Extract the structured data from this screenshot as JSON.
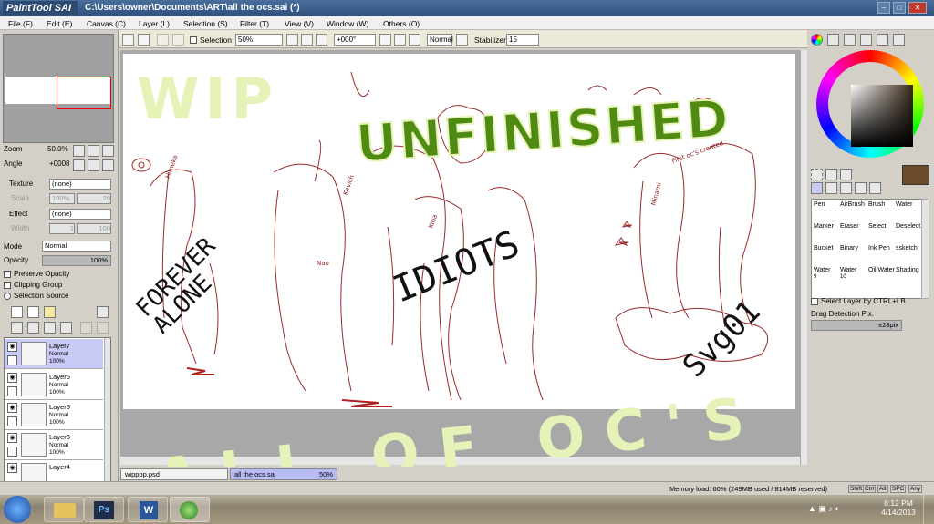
{
  "title": {
    "app_logo": "PaintTool SAI",
    "path": "C:\\Users\\owner\\Documents\\ART\\all the ocs.sai (*)"
  },
  "menu": [
    "File (F)",
    "Edit (E)",
    "Canvas (C)",
    "Layer (L)",
    "Selection (S)",
    "Filter (T)",
    "View (V)",
    "Window (W)",
    "Others (O)"
  ],
  "toolbar": {
    "selection_label": "Selection",
    "zoom": "50%",
    "rotation": "+000°",
    "blend": "Normal",
    "stabilizer_label": "Stabilizer",
    "stabilizer_value": "15"
  },
  "left": {
    "zoom_label": "Zoom",
    "zoom_value": "50.0%",
    "angle_label": "Angle",
    "angle_value": "+0008",
    "texture_label": "Texture",
    "texture_value": "(none)",
    "scale_label": "Scale",
    "scale_value": "100%",
    "scale_num": "20",
    "effect_label": "Effect",
    "effect_value": "(none)",
    "width_label": "Width",
    "width_value": "1",
    "width_num": "100",
    "mode_label": "Mode",
    "mode_value": "Normal",
    "opacity_label": "Opacity",
    "opacity_value": "100%",
    "preserve_opacity": "Preserve Opacity",
    "clipping_group": "Clipping Group",
    "selection_source": "Selection Source",
    "layers": [
      {
        "name": "Layer7",
        "mode": "Normal",
        "opacity": "100%"
      },
      {
        "name": "Layer6",
        "mode": "Normal",
        "opacity": "100%"
      },
      {
        "name": "Layer5",
        "mode": "Normal",
        "opacity": "100%"
      },
      {
        "name": "Layer3",
        "mode": "Normal",
        "opacity": "100%"
      },
      {
        "name": "Layer4",
        "mode": "",
        "opacity": ""
      }
    ]
  },
  "overlay_text": {
    "wip": "WIP",
    "unfinished": "UNFINISHED",
    "all_of_ocs": "ALL OF OC'S",
    "forever_alone": "FOREVER ALONE",
    "idiots": "IDIOTS",
    "svg01": "Svg01"
  },
  "sketch_labels": {
    "himeka": "Himeka",
    "kevin": "Kevich",
    "kiria": "Kiria",
    "minami": "Minami",
    "first_ocs": "First oc's created",
    "nao": "Nao"
  },
  "tabs": [
    {
      "name": "wipppp.psd",
      "pct": ""
    },
    {
      "name": "all the ocs.sai",
      "pct": "50%"
    }
  ],
  "right": {
    "tools": [
      [
        "Pen",
        "AirBrush",
        "Brush",
        "Water"
      ],
      [
        "Marker",
        "Eraser",
        "Select",
        "Deselect"
      ],
      [
        "Bucket",
        "Binary",
        "Ink Pen",
        "ssketch"
      ],
      [
        "Water",
        "Water",
        "Oil Water",
        "Shading"
      ]
    ],
    "tool_sizes": [
      "9",
      "10",
      "",
      ""
    ],
    "select_layer": "Select Layer by CTRL+LB",
    "drag_detection": "Drag Detection Pix.",
    "drag_value": "±28pix"
  },
  "status": {
    "memory": "Memory load: 60% (249MB used / 814MB reserved)",
    "keys": [
      "Shift",
      "Ctrl",
      "Alt",
      "SPC",
      "Any"
    ]
  },
  "clock": {
    "time": "8:12 PM",
    "date": "4/14/2013"
  },
  "colors": {
    "accent": "#c8cbf5",
    "overlay_green": "#e6f3b8",
    "overlay_dark_green": "#4f8a12",
    "sketch": "#8a1d1d"
  }
}
